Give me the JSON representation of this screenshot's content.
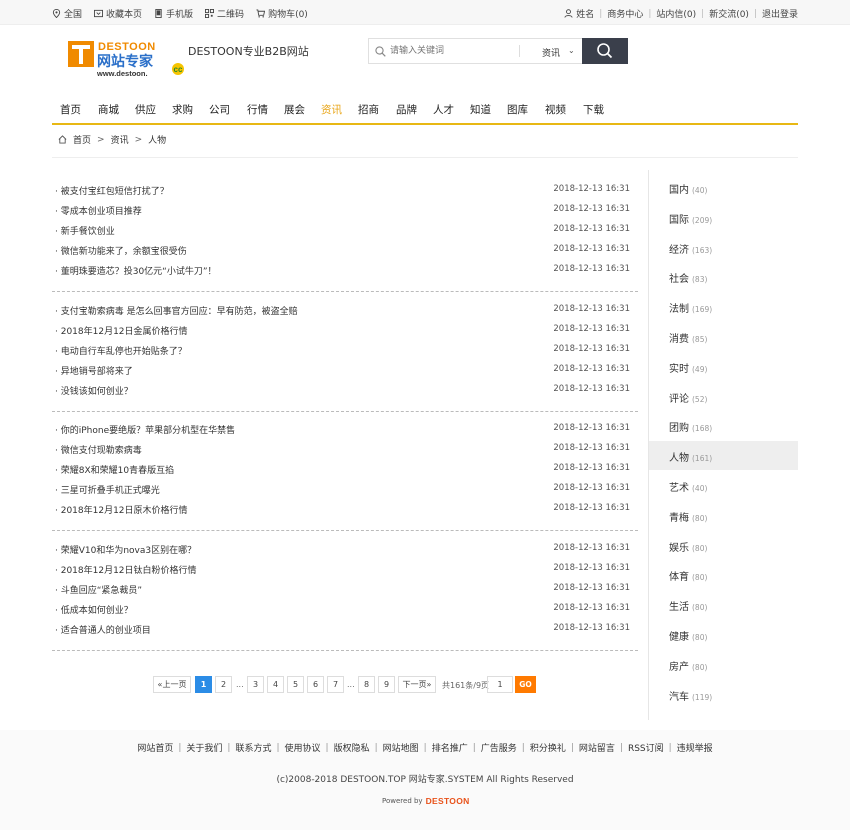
{
  "topbar": {
    "left": [
      "全国",
      "收藏本页",
      "手机版",
      "二维码",
      "购物车(0)"
    ],
    "right": [
      "姓名",
      "商务中心",
      "站内信(0)",
      "新交流(0)",
      "退出登录"
    ]
  },
  "header": {
    "logo_top": "DESTOON",
    "logo_main": "网站专家",
    "logo_url": "www.destoon.",
    "logo_cc": "cc",
    "site_name": "DESTOON专业B2B网站",
    "search_placeholder": "请输入关键词",
    "search_category": "资讯"
  },
  "nav": [
    "首页",
    "商城",
    "供应",
    "求购",
    "公司",
    "行情",
    "展会",
    "资讯",
    "招商",
    "品牌",
    "人才",
    "知道",
    "图库",
    "视频",
    "下载"
  ],
  "nav_active": "资讯",
  "breadcrumb": [
    "首页",
    "资讯",
    "人物"
  ],
  "articles": [
    {
      "title": "· 被支付宝红包短信打扰了？",
      "date": "2018-12-13 16:31"
    },
    {
      "title": "· 零成本创业项目推荐",
      "date": "2018-12-13 16:31"
    },
    {
      "title": "· 新手餐饮创业",
      "date": "2018-12-13 16:31"
    },
    {
      "title": "· 微信新功能来了，余额宝很受伤",
      "date": "2018-12-13 16:31"
    },
    {
      "title": "· 董明珠要造芯？投30亿元“小试牛刀”！",
      "date": "2018-12-13 16:31"
    },
    {
      "title": "· 支付宝勒索病毒 是怎么回事官方回应：早有防范，被盗全赔",
      "date": "2018-12-13 16:31"
    },
    {
      "title": "· 2018年12月12日金属价格行情",
      "date": "2018-12-13 16:31"
    },
    {
      "title": "· 电动自行车乱停也开始贴条了？",
      "date": "2018-12-13 16:31"
    },
    {
      "title": "· 异地销号部将来了",
      "date": "2018-12-13 16:31"
    },
    {
      "title": "· 没钱该如何创业？",
      "date": "2018-12-13 16:31"
    },
    {
      "title": "· 你的iPhone要绝版？苹果部分机型在华禁售",
      "date": "2018-12-13 16:31"
    },
    {
      "title": "· 微信支付现勒索病毒",
      "date": "2018-12-13 16:31"
    },
    {
      "title": "· 荣耀8X和荣耀10青春版互掐",
      "date": "2018-12-13 16:31"
    },
    {
      "title": "· 三星可折叠手机正式曝光",
      "date": "2018-12-13 16:31"
    },
    {
      "title": "· 2018年12月12日原木价格行情",
      "date": "2018-12-13 16:31"
    },
    {
      "title": "· 荣耀V10和华为nova3区别在哪？",
      "date": "2018-12-13 16:31"
    },
    {
      "title": "· 2018年12月12日钛白粉价格行情",
      "date": "2018-12-13 16:31"
    },
    {
      "title": "· 斗鱼回应“紧急裁员”",
      "date": "2018-12-13 16:31"
    },
    {
      "title": "· 低成本如何创业？",
      "date": "2018-12-13 16:31"
    },
    {
      "title": "· 适合普通人的创业项目",
      "date": "2018-12-13 16:31"
    }
  ],
  "sidebar": [
    {
      "name": "国内",
      "count": "(40)"
    },
    {
      "name": "国际",
      "count": "(209)"
    },
    {
      "name": "经济",
      "count": "(163)"
    },
    {
      "name": "社会",
      "count": "(83)"
    },
    {
      "name": "法制",
      "count": "(169)"
    },
    {
      "name": "消费",
      "count": "(85)"
    },
    {
      "name": "实时",
      "count": "(49)"
    },
    {
      "name": "评论",
      "count": "(52)"
    },
    {
      "name": "团购",
      "count": "(168)"
    },
    {
      "name": "人物",
      "count": "(161)"
    },
    {
      "name": "艺术",
      "count": "(40)"
    },
    {
      "name": "青梅",
      "count": "(80)"
    },
    {
      "name": "娱乐",
      "count": "(80)"
    },
    {
      "name": "体育",
      "count": "(80)"
    },
    {
      "name": "生活",
      "count": "(80)"
    },
    {
      "name": "健康",
      "count": "(80)"
    },
    {
      "name": "房产",
      "count": "(80)"
    },
    {
      "name": "汽车",
      "count": "(119)"
    }
  ],
  "sidebar_active": "人物",
  "pager": {
    "prev": "«上一页",
    "pages": [
      "1",
      "2",
      "3",
      "4",
      "5",
      "6",
      "7",
      "8",
      "9"
    ],
    "current": "1",
    "dots": "...",
    "next": "下一页»",
    "total": "共161条/9页",
    "input_value": "1",
    "go": "GO"
  },
  "footer": {
    "links": [
      "网站首页",
      "关于我们",
      "联系方式",
      "使用协议",
      "版权隐私",
      "网站地图",
      "排名推广",
      "广告服务",
      "积分换礼",
      "网站留言",
      "RSS订阅",
      "违规举报"
    ],
    "copyright": "(c)2008-2018 DESTOON.TOP 网站专家.SYSTEM All Rights Reserved",
    "powered_by": "Powered by",
    "powered_brand": "DESTOON"
  },
  "colors": {
    "accent": "#e8b814",
    "nav_active": "#e8a414",
    "page_current": "#2b8ce6",
    "go_button": "#ff7a00",
    "search_button": "#3a3f4b"
  }
}
